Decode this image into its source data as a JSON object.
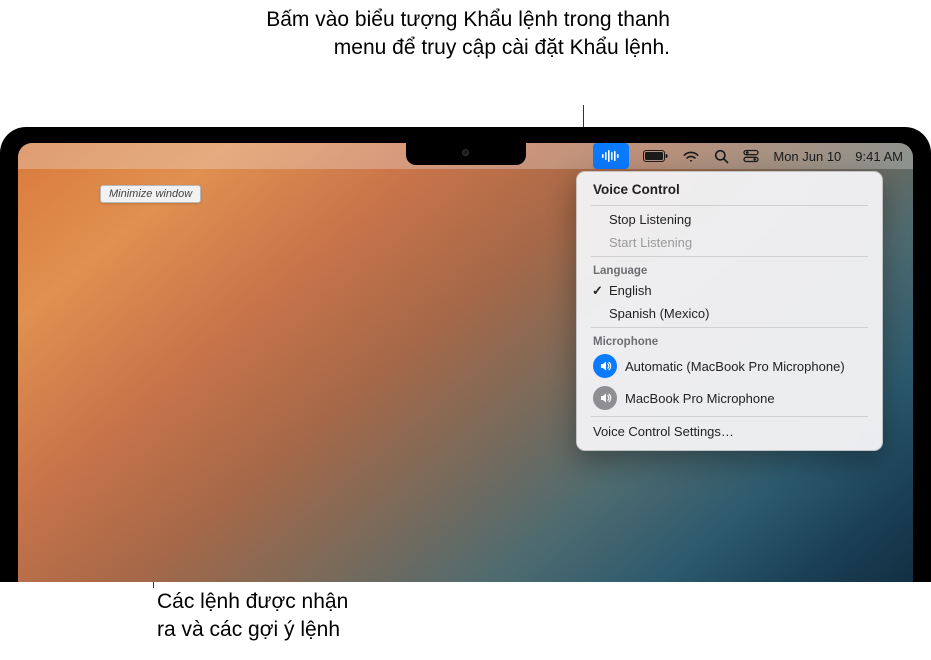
{
  "callouts": {
    "top": "Bấm vào biểu tượng Khẩu lệnh trong thanh menu để truy cập cài đặt Khẩu lệnh.",
    "bottom_line1": "Các lệnh được nhận",
    "bottom_line2": "ra và các gợi ý lệnh"
  },
  "menubar": {
    "date": "Mon Jun 10",
    "time": "9:41 AM"
  },
  "tooltip": {
    "text": "Minimize window"
  },
  "dropdown": {
    "title": "Voice Control",
    "stop": "Stop Listening",
    "start": "Start Listening",
    "language_header": "Language",
    "lang1": "English",
    "lang2": "Spanish (Mexico)",
    "microphone_header": "Microphone",
    "mic1": "Automatic (MacBook Pro Microphone)",
    "mic2": "MacBook Pro Microphone",
    "settings": "Voice Control Settings…"
  }
}
